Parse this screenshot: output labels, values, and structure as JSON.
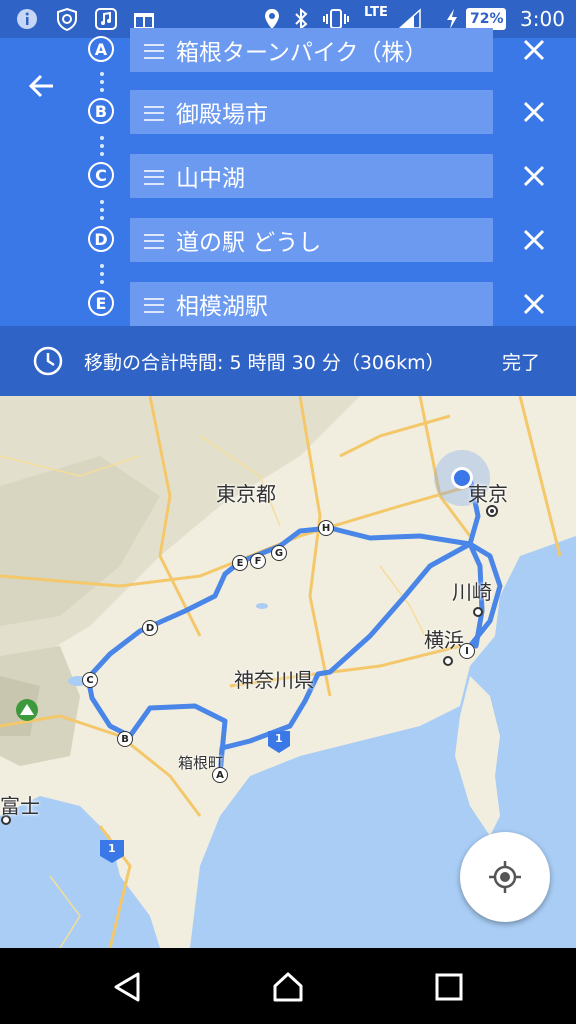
{
  "status_bar": {
    "network": "LTE",
    "battery": "72%",
    "time": "3:00"
  },
  "stops": [
    {
      "letter": "A",
      "name": "箱根ターンパイク（株）"
    },
    {
      "letter": "B",
      "name": "御殿場市"
    },
    {
      "letter": "C",
      "name": "山中湖"
    },
    {
      "letter": "D",
      "name": "道の駅 どうし"
    },
    {
      "letter": "E",
      "name": "相模湖駅"
    }
  ],
  "summary": {
    "text": "移動の合計時間: 5 時間 30 分（306km）",
    "done_label": "完了"
  },
  "map": {
    "labels": {
      "tokyo_to": "東京都",
      "tokyo": "東京",
      "kawasaki": "川崎",
      "yokohama": "横浜",
      "kanagawa": "神奈川県",
      "hakone": "箱根町",
      "fuji": "富士",
      "route1_a": "1",
      "route1_b": "1"
    },
    "route_markers": [
      "A",
      "B",
      "C",
      "D",
      "E",
      "F",
      "G",
      "H",
      "I"
    ]
  },
  "colors": {
    "header": "#3b78e7",
    "status_bar": "#2f63c6",
    "route": "#4a86e8",
    "water": "#a9cdf5"
  }
}
